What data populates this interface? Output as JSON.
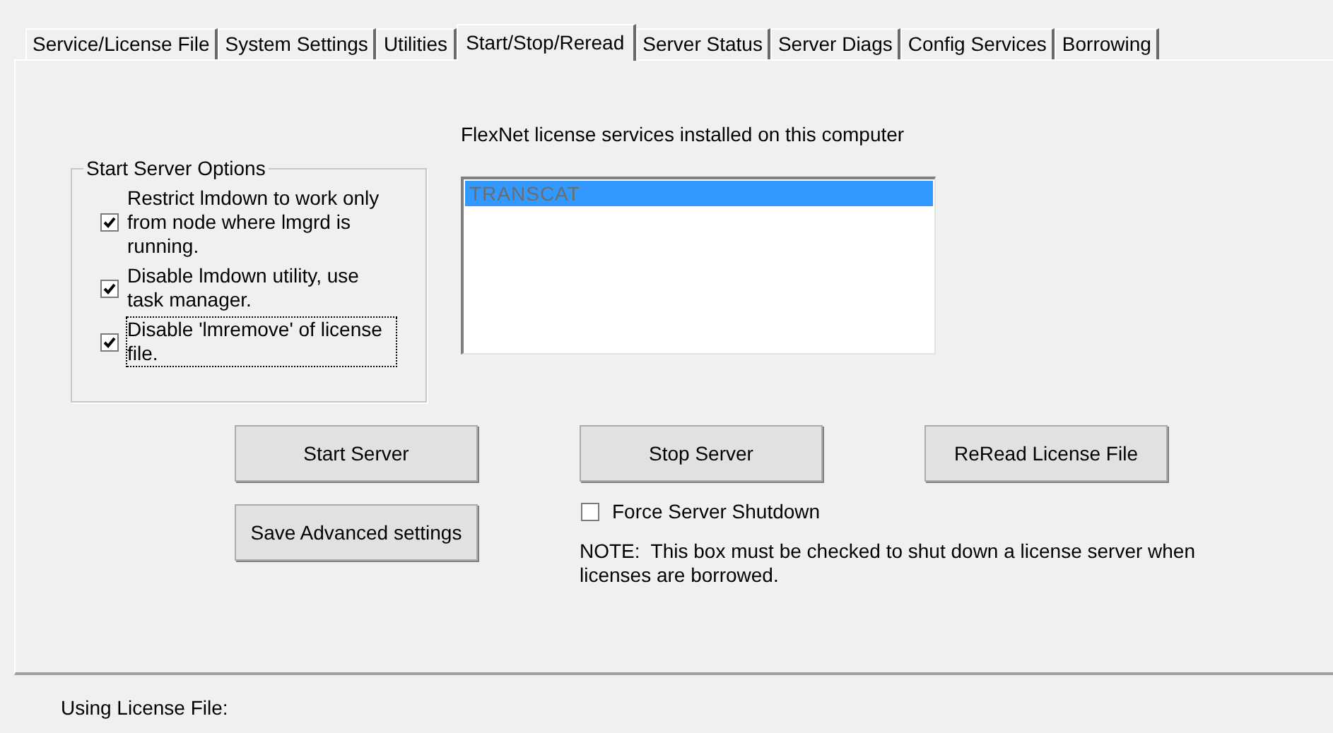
{
  "tabs": [
    {
      "label": "Service/License File",
      "selected": false
    },
    {
      "label": "System Settings",
      "selected": false
    },
    {
      "label": "Utilities",
      "selected": false
    },
    {
      "label": "Start/Stop/Reread",
      "selected": true
    },
    {
      "label": "Server Status",
      "selected": false
    },
    {
      "label": "Server Diags",
      "selected": false
    },
    {
      "label": "Config Services",
      "selected": false
    },
    {
      "label": "Borrowing",
      "selected": false
    }
  ],
  "start_options": {
    "title": "Start Server Options",
    "options": [
      {
        "label": "Restrict lmdown to work only from node where lmgrd is running.",
        "checked": true,
        "focused": false
      },
      {
        "label": "Disable lmdown utility, use task manager.",
        "checked": true,
        "focused": false
      },
      {
        "label": "Disable 'lmremove' of license file.",
        "checked": true,
        "focused": true
      }
    ]
  },
  "services": {
    "label": "FlexNet license services installed on this computer",
    "items": [
      {
        "text": "TRANSCAT",
        "selected": true
      }
    ]
  },
  "start_button": "Start Server",
  "save_button": "Save Advanced settings",
  "stop_button": "Stop Server",
  "force_shutdown": {
    "label": "Force Server Shutdown",
    "checked": false
  },
  "note": "NOTE:  This box must be checked to shut down a license server when licenses are borrowed.",
  "reread_button": "ReRead License File",
  "status_bar": {
    "label": "Using License File:"
  }
}
